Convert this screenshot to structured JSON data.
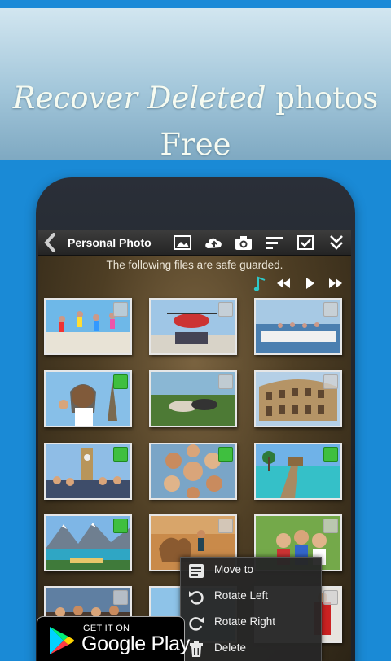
{
  "promo": {
    "headline_italic": "Recover Deleted",
    "headline_rest": "photos",
    "headline_line2": "Free"
  },
  "app": {
    "title": "Personal Photo",
    "notice": "The following files are safe guarded.",
    "toolbar_icons": [
      "image-icon",
      "cloud-upload-icon",
      "camera-icon",
      "sort-icon",
      "select-all-icon",
      "expand-more-icon"
    ],
    "media_icons": [
      "music-note-icon",
      "rewind-icon",
      "play-icon",
      "fast-forward-icon"
    ]
  },
  "photos": [
    {
      "subject": "beach jumping group",
      "checked": false
    },
    {
      "subject": "helicopter",
      "checked": false
    },
    {
      "subject": "boat group",
      "checked": false
    },
    {
      "subject": "eiffel tower selfie",
      "checked": true
    },
    {
      "subject": "lying on grass",
      "checked": false
    },
    {
      "subject": "colosseum",
      "checked": false
    },
    {
      "subject": "big ben group",
      "checked": true
    },
    {
      "subject": "friends circle",
      "checked": true
    },
    {
      "subject": "tropical pier",
      "checked": true
    },
    {
      "subject": "mountain lake",
      "checked": true
    },
    {
      "subject": "camel desert",
      "checked": false
    },
    {
      "subject": "friends park",
      "checked": false
    }
  ],
  "context_menu": [
    {
      "label": "Move to",
      "icon": "move-to-icon"
    },
    {
      "label": "Rotate Left",
      "icon": "rotate-left-icon"
    },
    {
      "label": "Rotate Right",
      "icon": "rotate-right-icon"
    },
    {
      "label": "Delete",
      "icon": "delete-icon"
    }
  ],
  "store_badge": {
    "small": "GET IT ON",
    "big": "Google Play"
  },
  "colors": {
    "background": "#1a8ad6",
    "check_on": "#3fbf3f",
    "action_bar": "#2e2e2e"
  }
}
